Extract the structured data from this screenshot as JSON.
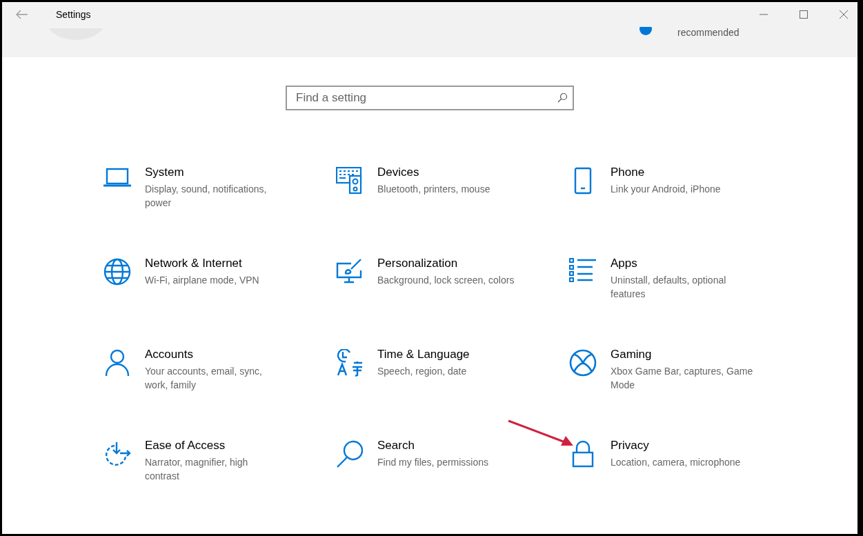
{
  "window": {
    "title": "Settings"
  },
  "header": {
    "status_text": "recommended"
  },
  "search": {
    "placeholder": "Find a setting"
  },
  "categories": [
    {
      "title": "System",
      "description": "Display, sound, notifications, power"
    },
    {
      "title": "Devices",
      "description": "Bluetooth, printers, mouse"
    },
    {
      "title": "Phone",
      "description": "Link your Android, iPhone"
    },
    {
      "title": "Network & Internet",
      "description": "Wi-Fi, airplane mode, VPN"
    },
    {
      "title": "Personalization",
      "description": "Background, lock screen, colors"
    },
    {
      "title": "Apps",
      "description": "Uninstall, defaults, optional features"
    },
    {
      "title": "Accounts",
      "description": "Your accounts, email, sync, work, family"
    },
    {
      "title": "Time & Language",
      "description": "Speech, region, date"
    },
    {
      "title": "Gaming",
      "description": "Xbox Game Bar, captures, Game Mode"
    },
    {
      "title": "Ease of Access",
      "description": "Narrator, magnifier, high contrast"
    },
    {
      "title": "Search",
      "description": "Find my files, permissions"
    },
    {
      "title": "Privacy",
      "description": "Location, camera, microphone"
    }
  ]
}
